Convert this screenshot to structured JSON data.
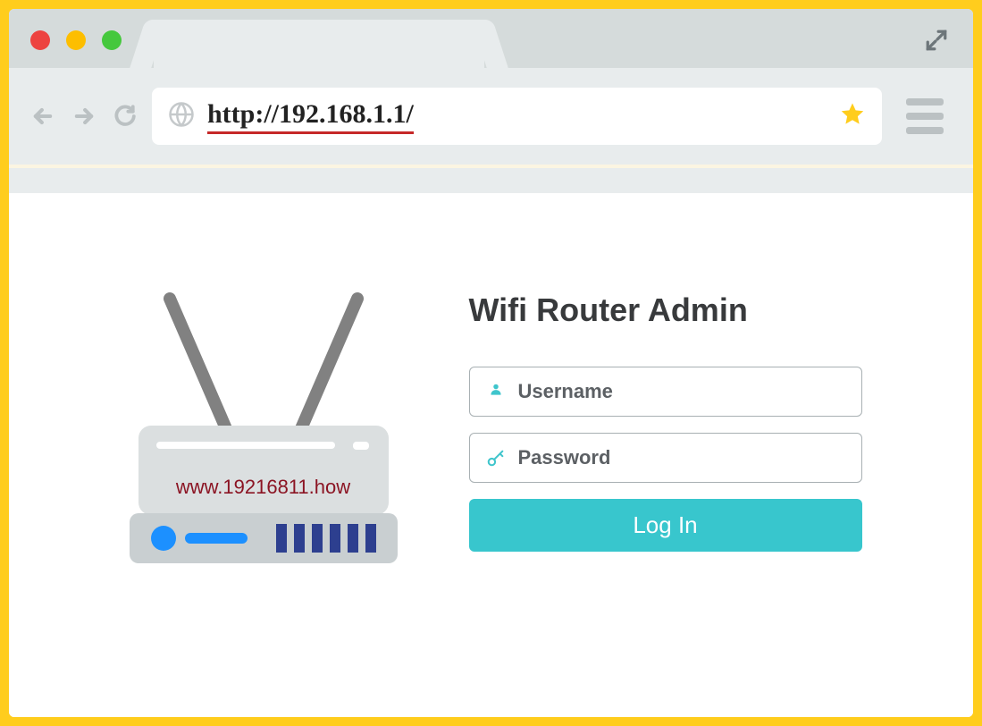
{
  "browser": {
    "url": "http://192.168.1.1/",
    "traffic_colors": {
      "close": "#ed4340",
      "min": "#fdbe00",
      "max": "#45c83d"
    }
  },
  "page": {
    "title": "Wifi Router Admin",
    "router_label": "www.19216811.how",
    "fields": {
      "username_placeholder": "Username",
      "password_placeholder": "Password"
    },
    "login_button": "Log In"
  }
}
